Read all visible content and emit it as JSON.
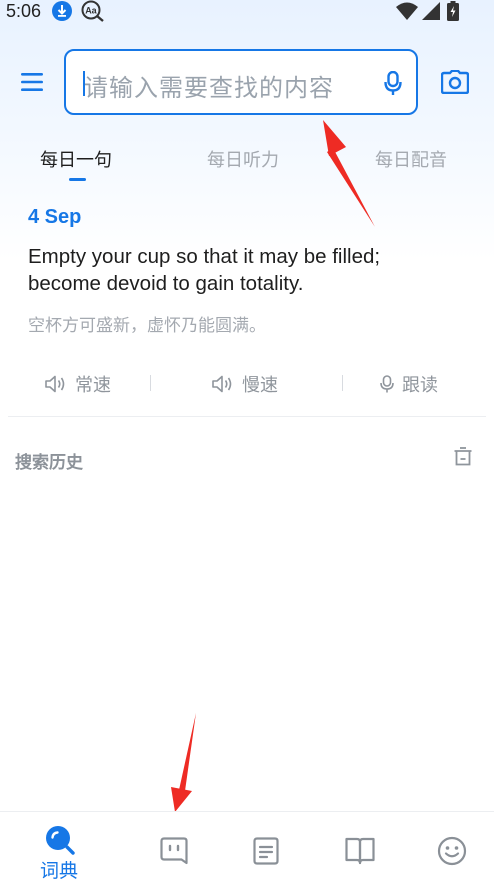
{
  "status_bar": {
    "time": "5:06",
    "left_icons": [
      "download-icon",
      "aa-translate-icon"
    ],
    "right_icons": [
      "wifi-icon",
      "cellular-icon",
      "battery-charging-icon"
    ]
  },
  "header": {
    "menu_icon": "hamburger-menu-icon",
    "search_placeholder": "请输入需要查找的内容",
    "voice_icon": "microphone-icon",
    "camera_icon": "camera-icon"
  },
  "tabs": [
    {
      "label": "每日一句",
      "active": true
    },
    {
      "label": "每日听力",
      "active": false
    },
    {
      "label": "每日配音",
      "active": false
    }
  ],
  "daily_sentence": {
    "date": "4 Sep",
    "english": "Empty your cup so that it may be filled; become devoid to gain totality.",
    "chinese": "空杯方可盛新，虚怀乃能圆满。"
  },
  "actions": [
    {
      "label": "常速",
      "icon": "speaker-icon"
    },
    {
      "label": "慢速",
      "icon": "speaker-icon"
    },
    {
      "label": "跟读",
      "icon": "microphone-icon"
    }
  ],
  "search_history": {
    "title": "搜索历史",
    "clear_icon": "trash-icon"
  },
  "bottom_nav": [
    {
      "label": "词典",
      "icon": "dictionary-search-icon",
      "active": true
    },
    {
      "label": "",
      "icon": "chat-bot-icon",
      "active": false
    },
    {
      "label": "",
      "icon": "notes-icon",
      "active": false
    },
    {
      "label": "",
      "icon": "book-icon",
      "active": false
    },
    {
      "label": "",
      "icon": "smiley-icon",
      "active": false
    }
  ],
  "colors": {
    "accent": "#1677e6",
    "annotation_arrow": "#ee2b24",
    "muted_text": "#a4a9b0"
  }
}
